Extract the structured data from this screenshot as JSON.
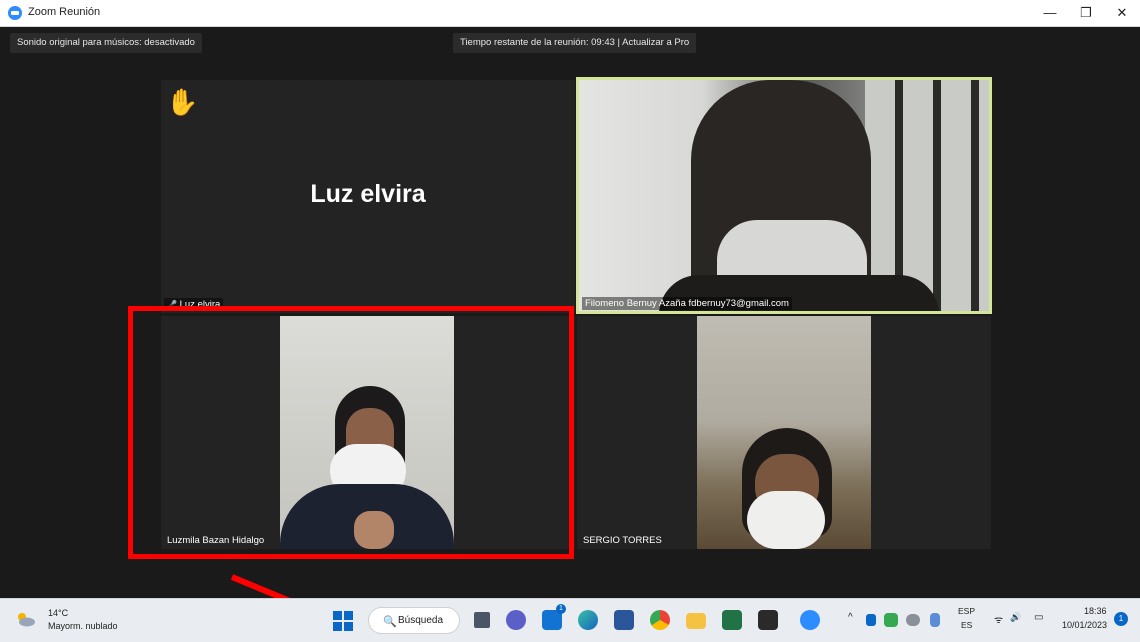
{
  "window": {
    "title": "Zoom Reunión",
    "min_symbol": "—",
    "max_symbol": "❐",
    "close_symbol": "✕"
  },
  "meeting_bar": {
    "original_sound": "Sonido original para músicos: desactivado",
    "time_remaining": "Tiempo restante de la reunión: 09:43 | Actualizar a Pro"
  },
  "participants": [
    {
      "name": "Luz elvira",
      "display_name": "Luz elvira",
      "video": false,
      "hand_raised": true,
      "muted": true,
      "hand_icon": "✋",
      "mic_icon": "🎤"
    },
    {
      "name": "Filomeno Bernuy Azaña fdbernuy73@gmail.com",
      "video": true,
      "active_speaker": true
    },
    {
      "name": "Luzmila Bazan Hidalgo",
      "video": true
    },
    {
      "name": "SERGIO TORRES",
      "video": true
    }
  ],
  "colors": {
    "active_speaker_border": "#d4e59a",
    "annotation_red": "#ff0000",
    "zoom_blue": "#2d8cff"
  },
  "taskbar": {
    "weather_temp": "14°C",
    "weather_desc": "Mayorm. nublado",
    "search_icon": "🔍",
    "search_label": "Búsqueda",
    "language_top": "ESP",
    "language_bottom": "ES",
    "tray_chevron": "^",
    "tray_wifi": "ᯤ",
    "tray_sound": "🔊",
    "tray_battery": "▭",
    "clock_time": "18:36",
    "clock_date": "10/01/2023",
    "notification_count": "1",
    "pinned_icons": [
      "task-view-icon",
      "teams-chat-icon",
      "mail-icon",
      "edge-icon",
      "word-icon",
      "chrome-icon",
      "file-explorer-icon",
      "excel-icon",
      "store-icon",
      "zoom-icon"
    ]
  }
}
